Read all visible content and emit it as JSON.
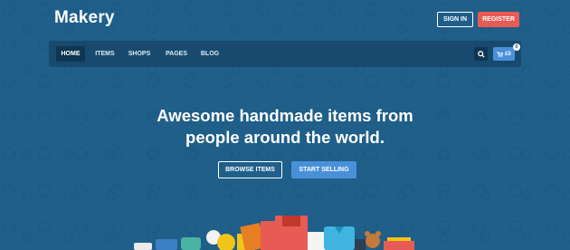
{
  "brand": {
    "name": "Makery"
  },
  "auth": {
    "signin_label": "SIGN IN",
    "register_label": "REGISTER"
  },
  "nav": {
    "items": [
      {
        "label": "HOME",
        "active": true
      },
      {
        "label": "ITEMS"
      },
      {
        "label": "SHOPS"
      },
      {
        "label": "PAGES"
      },
      {
        "label": "BLOG"
      }
    ],
    "search_icon": "search-icon",
    "cart": {
      "icon": "cart-icon",
      "label": "£0",
      "count": "0"
    }
  },
  "hero": {
    "line1": "Awesome handmade items from",
    "line2": "people around the world.",
    "browse_label": "BROWSE ITEMS",
    "sell_label": "START SELLING"
  },
  "colors": {
    "background": "#1f5f8a",
    "navbar": "#174a6e",
    "register": "#e85b54",
    "accent": "#4a90d9"
  }
}
